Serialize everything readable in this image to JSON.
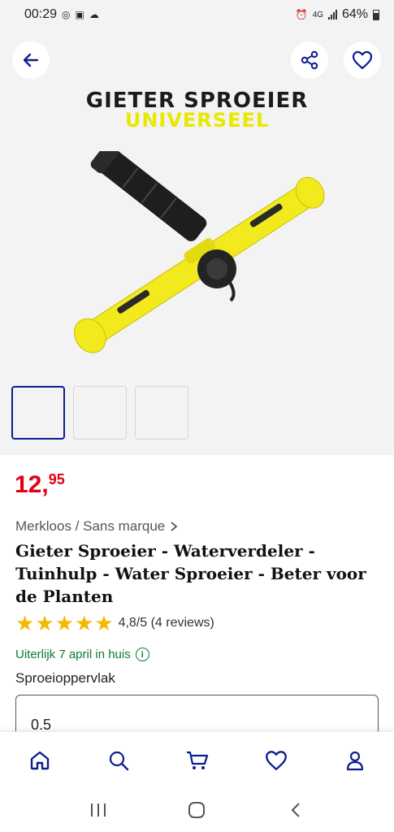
{
  "status_bar": {
    "time": "00:29",
    "network": "4G",
    "battery": "64%"
  },
  "hero": {
    "title_line1": "GIETER SPROEIER",
    "title_line2": "UNIVERSEEL",
    "thumbnail_count": 3
  },
  "product": {
    "price_int": "12,",
    "price_dec": "95",
    "brand": "Merkloos / Sans marque",
    "title": "Gieter Sproeier - Waterverdeler - Tuinhulp - Water Sproeier - Beter voor de Planten",
    "rating_text": "4,8/5 (4 reviews)",
    "rating_value": 4.8,
    "delivery": "Uiterlijk 7 april in huis",
    "variant_label": "Sproeioppervlak",
    "variant_value": "0.5"
  },
  "icons": {
    "back": "arrow-left-icon",
    "share": "share-icon",
    "favorite": "heart-icon",
    "nav_home": "home-icon",
    "nav_search": "search-icon",
    "nav_cart": "cart-icon",
    "nav_wishlist": "heart-icon",
    "nav_account": "user-icon"
  },
  "colors": {
    "price": "#e0001a",
    "brand_blue": "#0a1f8f",
    "delivery_green": "#0a7a33",
    "star": "#f5b800",
    "product_yellow": "#f2ea1c"
  }
}
